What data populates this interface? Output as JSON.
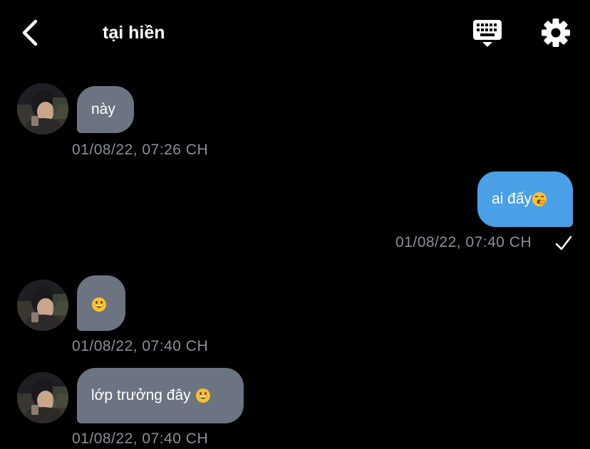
{
  "header": {
    "title": "tại hiền",
    "back_icon": "chevron-left-icon",
    "keyboard_icon": "keyboard-icon",
    "settings_icon": "gear-icon"
  },
  "colors": {
    "background": "#000000",
    "incoming_bubble": "#6b7480",
    "outgoing_bubble": "#4aa0e6",
    "timestamp": "#8a8f99"
  },
  "messages": [
    {
      "direction": "incoming",
      "text": "này",
      "timestamp": "01/08/22, 07:26 CH"
    },
    {
      "direction": "outgoing",
      "text": "ai đấy",
      "emoji": "yawning-face",
      "timestamp": "01/08/22, 07:40 CH",
      "status_icon": "check-icon"
    },
    {
      "direction": "incoming",
      "text": "",
      "emoji": "grinning-face",
      "timestamp": "01/08/22, 07:40 CH"
    },
    {
      "direction": "incoming",
      "text": "lớp trưởng đây ",
      "emoji": "grinning-face",
      "timestamp": "01/08/22, 07:40 CH"
    }
  ]
}
